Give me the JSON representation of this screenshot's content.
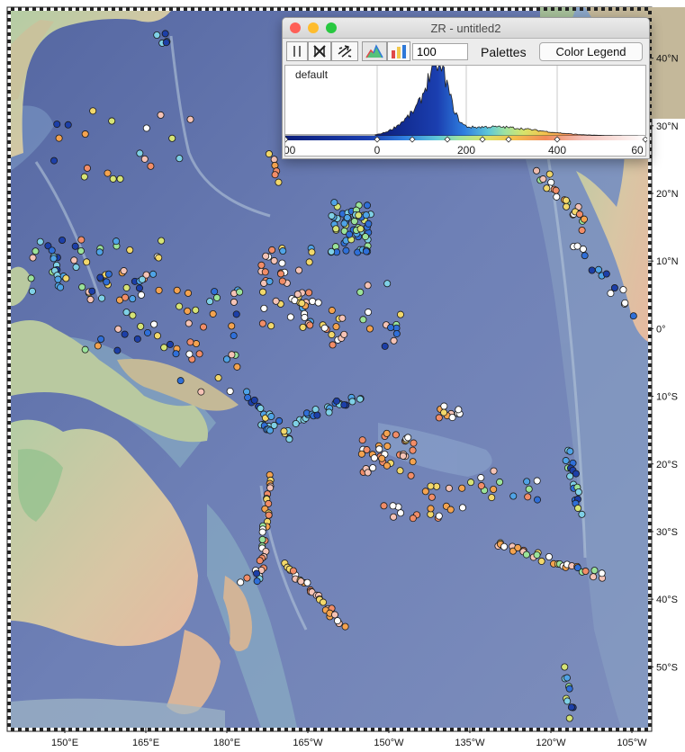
{
  "window": {
    "title": "ZR - untitled2",
    "value_field": "100",
    "palettes_label": "Palettes",
    "color_legend_label": "Color Legend",
    "palette_name": "default",
    "hist_axis_labels": [
      "00",
      "0",
      "200",
      "400",
      "60"
    ],
    "traffic_colors": [
      "#fe5f57",
      "#febc2e",
      "#28c840"
    ]
  },
  "map": {
    "lon_labels": [
      "150°E",
      "165°E",
      "180°E",
      "165°W",
      "150°W",
      "135°W",
      "120°W",
      "105°W"
    ],
    "lat_labels": [
      "40°N",
      "30°N",
      "20°N",
      "10°N",
      "0°",
      "10°S",
      "20°S",
      "30°S",
      "40°S",
      "50°S"
    ],
    "lon_ticks": [
      150,
      165,
      180,
      195,
      210,
      225,
      240,
      255
    ],
    "lat_ticks": [
      40,
      30,
      20,
      10,
      0,
      -10,
      -20,
      -30,
      -40,
      -50
    ],
    "lon_range": [
      140,
      258
    ],
    "lat_range": [
      -59,
      47
    ],
    "colors": {
      "ocean_deep": "#5b6aa3",
      "ocean_mid": "#7688b8",
      "ridge": "#a5b8cc",
      "shelf": "#8ec7c4",
      "land_low": "#a9c8a2",
      "land_high": "#e0bba0",
      "samples": [
        "#1c3fa8",
        "#2f6fd8",
        "#4fa3e6",
        "#7fd0e6",
        "#9be39a",
        "#d6e476",
        "#f2d86b",
        "#f4a34f",
        "#f28d68",
        "#f5c3b6",
        "#ffffff"
      ]
    }
  }
}
